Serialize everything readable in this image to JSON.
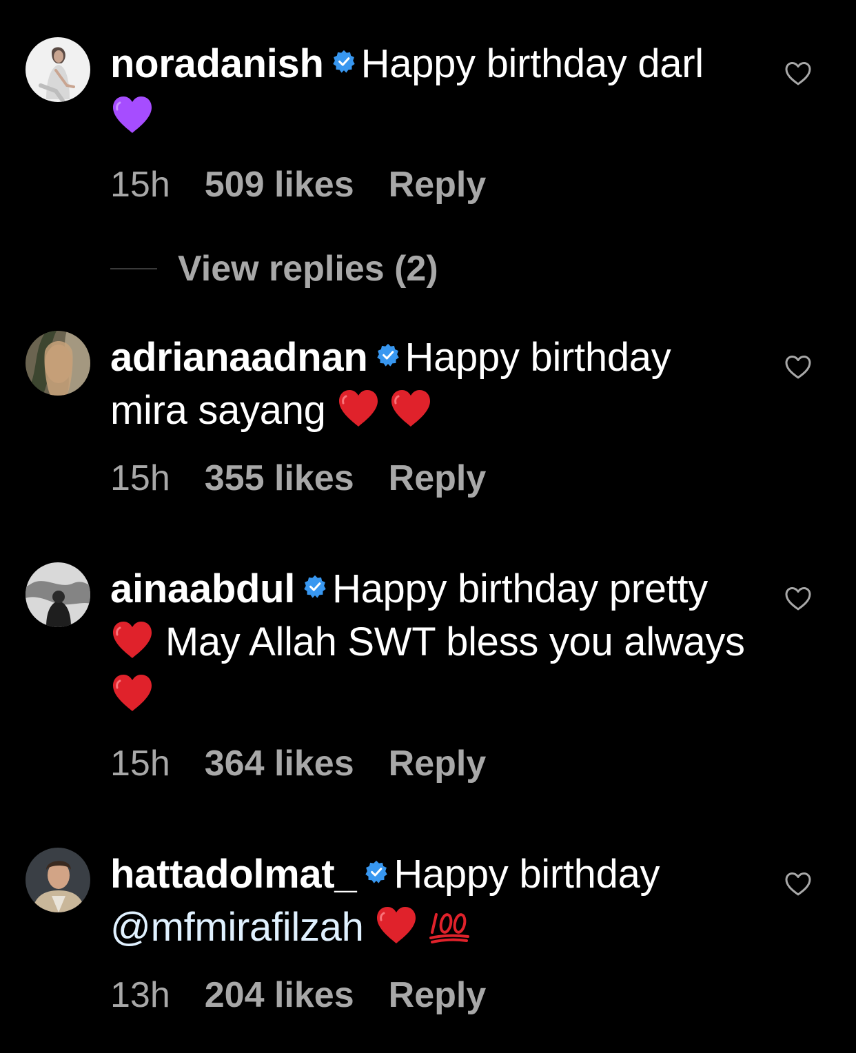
{
  "comments": [
    {
      "username": "noradanish",
      "text_1": "Happy birthday darl",
      "time": "15h",
      "likes": "509 likes",
      "reply": "Reply",
      "emoji": [
        "purple-heart"
      ]
    },
    {
      "username": "adrianaadnan",
      "text_1": "Happy birthday mira sayang",
      "time": "15h",
      "likes": "355 likes",
      "reply": "Reply",
      "emoji": [
        "red-heart",
        "red-heart"
      ]
    },
    {
      "username": "ainaabdul",
      "text_1": "Happy birthday pretty",
      "text_2": "May Allah SWT bless you always",
      "time": "15h",
      "likes": "364 likes",
      "reply": "Reply",
      "emoji": [
        "red-heart",
        "red-heart"
      ]
    },
    {
      "username": "hattadolmat_",
      "text_1": "Happy birthday",
      "mention": "@mfmirafilzah",
      "time": "13h",
      "likes": "204 likes",
      "reply": "Reply",
      "emoji": [
        "red-heart",
        "hundred-points"
      ]
    }
  ],
  "view_replies": "View replies (2)",
  "colors": {
    "background": "#000000",
    "text": "#ffffff",
    "meta": "#a8a8a8",
    "verified": "#3897f0",
    "mention": "#e0f1ff"
  }
}
